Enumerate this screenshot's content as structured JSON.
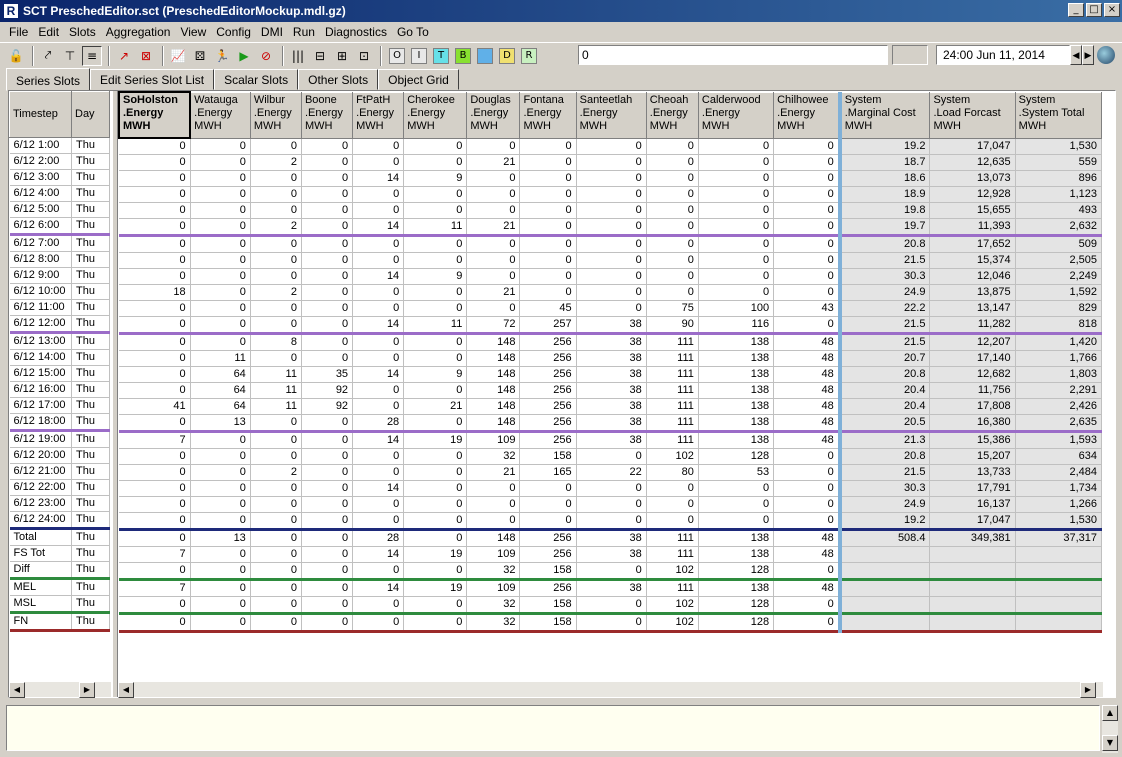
{
  "window": {
    "title": "SCT PreschedEditor.sct (PreschedEditorMockup.mdl.gz)"
  },
  "menu": [
    "File",
    "Edit",
    "Slots",
    "Aggregation",
    "View",
    "Config",
    "DMI",
    "Run",
    "Diagnostics",
    "Go To"
  ],
  "toolbar": {
    "value_input": "0",
    "date": "24:00 Jun 11, 2014",
    "flag_buttons": [
      {
        "label": "O",
        "color": "#e8e8e8"
      },
      {
        "label": "I",
        "color": "#e8e8e8"
      },
      {
        "label": "T",
        "color": "#66e0e8"
      },
      {
        "label": "B",
        "color": "#88e030"
      },
      {
        "label": "",
        "color": "#60b0e8"
      },
      {
        "label": "D",
        "color": "#f0e070"
      },
      {
        "label": "R",
        "color": "#c8f0c0"
      }
    ]
  },
  "tabs": [
    "Series Slots",
    "Edit Series Slot List",
    "Scalar Slots",
    "Other Slots",
    "Object Grid"
  ],
  "left_headers": [
    "Timestep",
    "Day"
  ],
  "headers": [
    "SoHolston\n.Energy\nMWH",
    "Watauga\n.Energy\nMWH",
    "Wilbur\n.Energy\nMWH",
    "Boone\n.Energy\nMWH",
    "FtPatH\n.Energy\nMWH",
    "Cherokee\n.Energy\nMWH",
    "Douglas\n.Energy\nMWH",
    "Fontana\n.Energy\nMWH",
    "Santeetlah\n.Energy\nMWH",
    "Cheoah\n.Energy\nMWH",
    "Calderwood\n.Energy\nMWH",
    "Chilhowee\n.Energy\nMWH",
    "System\n.Marginal Cost\nMWH",
    "System\n.Load Forcast\nMWH",
    "System\n.System Total\nMWH"
  ],
  "rows": [
    {
      "t": "6/12 1:00",
      "d": "Thu",
      "v": [
        "0",
        "0",
        "0",
        "0",
        "0",
        "0",
        "0",
        "0",
        "0",
        "0",
        "0",
        "0",
        "19.2",
        "17,047",
        "1,530"
      ]
    },
    {
      "t": "6/12 2:00",
      "d": "Thu",
      "v": [
        "0",
        "0",
        "2",
        "0",
        "0",
        "0",
        "21",
        "0",
        "0",
        "0",
        "0",
        "0",
        "18.7",
        "12,635",
        "559"
      ]
    },
    {
      "t": "6/12 3:00",
      "d": "Thu",
      "v": [
        "0",
        "0",
        "0",
        "0",
        "14",
        "9",
        "0",
        "0",
        "0",
        "0",
        "0",
        "0",
        "18.6",
        "13,073",
        "896"
      ]
    },
    {
      "t": "6/12 4:00",
      "d": "Thu",
      "v": [
        "0",
        "0",
        "0",
        "0",
        "0",
        "0",
        "0",
        "0",
        "0",
        "0",
        "0",
        "0",
        "18.9",
        "12,928",
        "1,123"
      ]
    },
    {
      "t": "6/12 5:00",
      "d": "Thu",
      "v": [
        "0",
        "0",
        "0",
        "0",
        "0",
        "0",
        "0",
        "0",
        "0",
        "0",
        "0",
        "0",
        "19.8",
        "15,655",
        "493"
      ]
    },
    {
      "t": "6/12 6:00",
      "d": "Thu",
      "v": [
        "0",
        "0",
        "2",
        "0",
        "14",
        "11",
        "21",
        "0",
        "0",
        "0",
        "0",
        "0",
        "19.7",
        "11,393",
        "2,632"
      ],
      "sep": "purple"
    },
    {
      "t": "6/12 7:00",
      "d": "Thu",
      "v": [
        "0",
        "0",
        "0",
        "0",
        "0",
        "0",
        "0",
        "0",
        "0",
        "0",
        "0",
        "0",
        "20.8",
        "17,652",
        "509"
      ]
    },
    {
      "t": "6/12 8:00",
      "d": "Thu",
      "v": [
        "0",
        "0",
        "0",
        "0",
        "0",
        "0",
        "0",
        "0",
        "0",
        "0",
        "0",
        "0",
        "21.5",
        "15,374",
        "2,505"
      ]
    },
    {
      "t": "6/12 9:00",
      "d": "Thu",
      "v": [
        "0",
        "0",
        "0",
        "0",
        "14",
        "9",
        "0",
        "0",
        "0",
        "0",
        "0",
        "0",
        "30.3",
        "12,046",
        "2,249"
      ]
    },
    {
      "t": "6/12 10:00",
      "d": "Thu",
      "v": [
        "18",
        "0",
        "2",
        "0",
        "0",
        "0",
        "21",
        "0",
        "0",
        "0",
        "0",
        "0",
        "24.9",
        "13,875",
        "1,592"
      ]
    },
    {
      "t": "6/12 11:00",
      "d": "Thu",
      "v": [
        "0",
        "0",
        "0",
        "0",
        "0",
        "0",
        "0",
        "45",
        "0",
        "75",
        "100",
        "43",
        "22.2",
        "13,147",
        "829"
      ]
    },
    {
      "t": "6/12 12:00",
      "d": "Thu",
      "v": [
        "0",
        "0",
        "0",
        "0",
        "14",
        "11",
        "72",
        "257",
        "38",
        "90",
        "116",
        "0",
        "21.5",
        "11,282",
        "818"
      ],
      "sep": "purple"
    },
    {
      "t": "6/12 13:00",
      "d": "Thu",
      "v": [
        "0",
        "0",
        "8",
        "0",
        "0",
        "0",
        "148",
        "256",
        "38",
        "111",
        "138",
        "48",
        "21.5",
        "12,207",
        "1,420"
      ]
    },
    {
      "t": "6/12 14:00",
      "d": "Thu",
      "v": [
        "0",
        "11",
        "0",
        "0",
        "0",
        "0",
        "148",
        "256",
        "38",
        "111",
        "138",
        "48",
        "20.7",
        "17,140",
        "1,766"
      ]
    },
    {
      "t": "6/12 15:00",
      "d": "Thu",
      "v": [
        "0",
        "64",
        "11",
        "35",
        "14",
        "9",
        "148",
        "256",
        "38",
        "111",
        "138",
        "48",
        "20.8",
        "12,682",
        "1,803"
      ]
    },
    {
      "t": "6/12 16:00",
      "d": "Thu",
      "v": [
        "0",
        "64",
        "11",
        "92",
        "0",
        "0",
        "148",
        "256",
        "38",
        "111",
        "138",
        "48",
        "20.4",
        "11,756",
        "2,291"
      ]
    },
    {
      "t": "6/12 17:00",
      "d": "Thu",
      "v": [
        "41",
        "64",
        "11",
        "92",
        "0",
        "21",
        "148",
        "256",
        "38",
        "111",
        "138",
        "48",
        "20.4",
        "17,808",
        "2,426"
      ]
    },
    {
      "t": "6/12 18:00",
      "d": "Thu",
      "v": [
        "0",
        "13",
        "0",
        "0",
        "28",
        "0",
        "148",
        "256",
        "38",
        "111",
        "138",
        "48",
        "20.5",
        "16,380",
        "2,635"
      ],
      "sep": "purple"
    },
    {
      "t": "6/12 19:00",
      "d": "Thu",
      "v": [
        "7",
        "0",
        "0",
        "0",
        "14",
        "19",
        "109",
        "256",
        "38",
        "111",
        "138",
        "48",
        "21.3",
        "15,386",
        "1,593"
      ]
    },
    {
      "t": "6/12 20:00",
      "d": "Thu",
      "v": [
        "0",
        "0",
        "0",
        "0",
        "0",
        "0",
        "32",
        "158",
        "0",
        "102",
        "128",
        "0",
        "20.8",
        "15,207",
        "634"
      ]
    },
    {
      "t": "6/12 21:00",
      "d": "Thu",
      "v": [
        "0",
        "0",
        "2",
        "0",
        "0",
        "0",
        "21",
        "165",
        "22",
        "80",
        "53",
        "0",
        "21.5",
        "13,733",
        "2,484"
      ]
    },
    {
      "t": "6/12 22:00",
      "d": "Thu",
      "v": [
        "0",
        "0",
        "0",
        "0",
        "14",
        "0",
        "0",
        "0",
        "0",
        "0",
        "0",
        "0",
        "30.3",
        "17,791",
        "1,734"
      ]
    },
    {
      "t": "6/12 23:00",
      "d": "Thu",
      "v": [
        "0",
        "0",
        "0",
        "0",
        "0",
        "0",
        "0",
        "0",
        "0",
        "0",
        "0",
        "0",
        "24.9",
        "16,137",
        "1,266"
      ]
    },
    {
      "t": "6/12 24:00",
      "d": "Thu",
      "v": [
        "0",
        "0",
        "0",
        "0",
        "0",
        "0",
        "0",
        "0",
        "0",
        "0",
        "0",
        "0",
        "19.2",
        "17,047",
        "1,530"
      ],
      "sep": "navy"
    },
    {
      "t": "Total",
      "d": "Thu",
      "v": [
        "0",
        "13",
        "0",
        "0",
        "28",
        "0",
        "148",
        "256",
        "38",
        "111",
        "138",
        "48",
        "508.4",
        "349,381",
        "37,317"
      ]
    },
    {
      "t": "FS Tot",
      "d": "Thu",
      "v": [
        "7",
        "0",
        "0",
        "0",
        "14",
        "19",
        "109",
        "256",
        "38",
        "111",
        "138",
        "48",
        "",
        "",
        ""
      ]
    },
    {
      "t": "Diff",
      "d": "Thu",
      "v": [
        "0",
        "0",
        "0",
        "0",
        "0",
        "0",
        "32",
        "158",
        "0",
        "102",
        "128",
        "0",
        "",
        "",
        ""
      ],
      "sep": "green"
    },
    {
      "t": "MEL",
      "d": "Thu",
      "v": [
        "7",
        "0",
        "0",
        "0",
        "14",
        "19",
        "109",
        "256",
        "38",
        "111",
        "138",
        "48",
        "",
        "",
        ""
      ]
    },
    {
      "t": "MSL",
      "d": "Thu",
      "v": [
        "0",
        "0",
        "0",
        "0",
        "0",
        "0",
        "32",
        "158",
        "0",
        "102",
        "128",
        "0",
        "",
        "",
        ""
      ],
      "sep": "green"
    },
    {
      "t": "FN",
      "d": "Thu",
      "v": [
        "0",
        "0",
        "0",
        "0",
        "0",
        "0",
        "32",
        "158",
        "0",
        "102",
        "128",
        "0",
        "",
        "",
        ""
      ],
      "sep": "red"
    }
  ]
}
